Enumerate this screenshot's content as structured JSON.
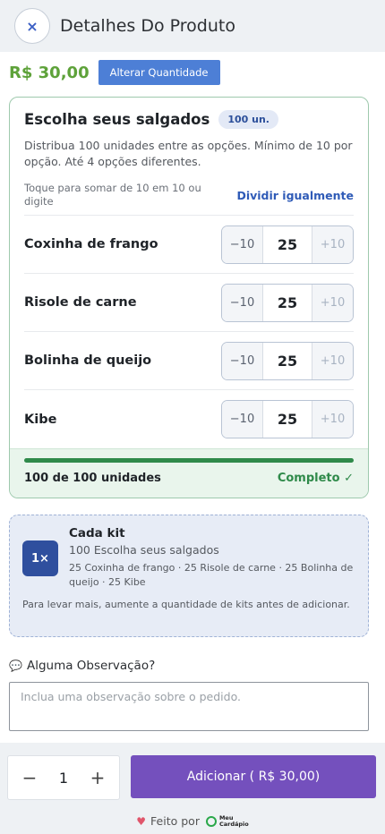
{
  "header": {
    "title": "Detalhes Do Produto",
    "close_icon": "×"
  },
  "price": {
    "value": "R$ 30,00",
    "change_qty_label": "Alterar Quantidade"
  },
  "chooser": {
    "title": "Escolha seus salgados",
    "badge": "100 un.",
    "description": "Distribua 100 unidades entre as opções. Mínimo de 10 por opção. Até 4 opções diferentes.",
    "hint": "Toque para somar de 10 em 10 ou digite",
    "split_label": "Dividir igualmente",
    "options": [
      {
        "name": "Coxinha de frango",
        "minus": "−10",
        "value": "25",
        "plus": "+10"
      },
      {
        "name": "Risole de carne",
        "minus": "−10",
        "value": "25",
        "plus": "+10"
      },
      {
        "name": "Bolinha de queijo",
        "minus": "−10",
        "value": "25",
        "plus": "+10"
      },
      {
        "name": "Kibe",
        "minus": "−10",
        "value": "25",
        "plus": "+10"
      }
    ],
    "progress": {
      "count_text": "100 de 100 unidades",
      "status": "Completo ✓",
      "fraction": 1.0
    }
  },
  "kit": {
    "badge": "1×",
    "title": "Cada kit",
    "subtitle": "100 Escolha seus salgados",
    "detail": "25 Coxinha de frango · 25 Risole de carne · 25 Bolinha de queijo · 25 Kibe",
    "note": "Para levar mais, aumente a quantidade de kits antes de adicionar."
  },
  "observation": {
    "icon": "speech-bubble-icon",
    "label": "Alguma Observação?",
    "placeholder": "Inclua uma observação sobre o pedido."
  },
  "footer": {
    "minus": "−",
    "quantity": "1",
    "plus": "+",
    "add_label": "Adicionar ( R$ 30,00)",
    "made_by": "Feito por",
    "brand_line1": "Meu",
    "brand_line2": "Cardápio"
  },
  "colors": {
    "price_green": "#5ea23a",
    "accent_blue": "#4d7fd6",
    "add_purple": "#7450bd",
    "progress_green": "#2f8a4a"
  }
}
